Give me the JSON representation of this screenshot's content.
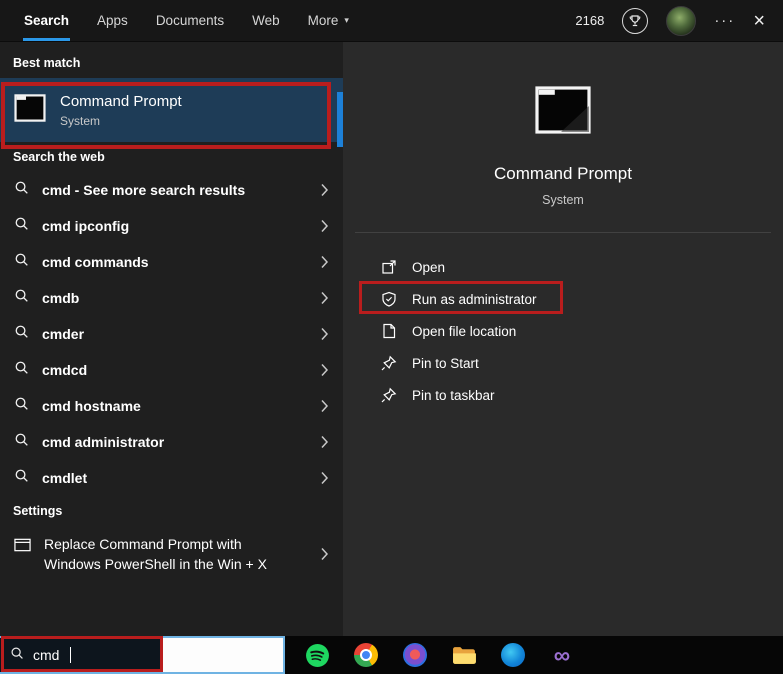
{
  "colors": {
    "accent_blue": "#2b98e8",
    "annotation_red": "#b91d1d",
    "selection_blue": "#1e3c57",
    "taskbar_black": "#060606"
  },
  "header": {
    "tabs": [
      {
        "label": "Search"
      },
      {
        "label": "Apps"
      },
      {
        "label": "Documents"
      },
      {
        "label": "Web"
      },
      {
        "label": "More"
      }
    ],
    "active_tab": "Search",
    "more_dropdown_glyph": "▾",
    "points": "2168",
    "ellipsis_glyph": "···",
    "close_glyph": "×"
  },
  "left_panel": {
    "best_match_label": "Best match",
    "best_match": {
      "title": "Command Prompt",
      "subtitle": "System"
    },
    "search_the_web_label": "Search the web",
    "suggestions": [
      {
        "query": "cmd",
        "rest": " - See more search results"
      },
      {
        "query": "cmd",
        "rest": " ipconfig"
      },
      {
        "query": "cmd",
        "rest": " commands"
      },
      {
        "query": "cmd",
        "rest": "b"
      },
      {
        "query": "cmd",
        "rest": "er"
      },
      {
        "query": "cmd",
        "rest": "cd"
      },
      {
        "query": "cmd",
        "rest": " hostname"
      },
      {
        "query": "cmd",
        "rest": " administrator"
      },
      {
        "query": "cmd",
        "rest": "let"
      }
    ],
    "settings_label": "Settings",
    "settings_item": {
      "text": "Replace Command Prompt with Windows PowerShell in the Win + X"
    }
  },
  "preview_panel": {
    "title": "Command Prompt",
    "subtitle": "System",
    "actions": [
      {
        "label": "Open"
      },
      {
        "label": "Run as administrator"
      },
      {
        "label": "Open file location"
      },
      {
        "label": "Pin to Start"
      },
      {
        "label": "Pin to taskbar"
      }
    ]
  },
  "taskbar": {
    "search_value": "cmd",
    "app_icons": [
      "spotify",
      "chrome",
      "colorful-app",
      "file-explorer",
      "blue-app",
      "visual-studio"
    ]
  }
}
